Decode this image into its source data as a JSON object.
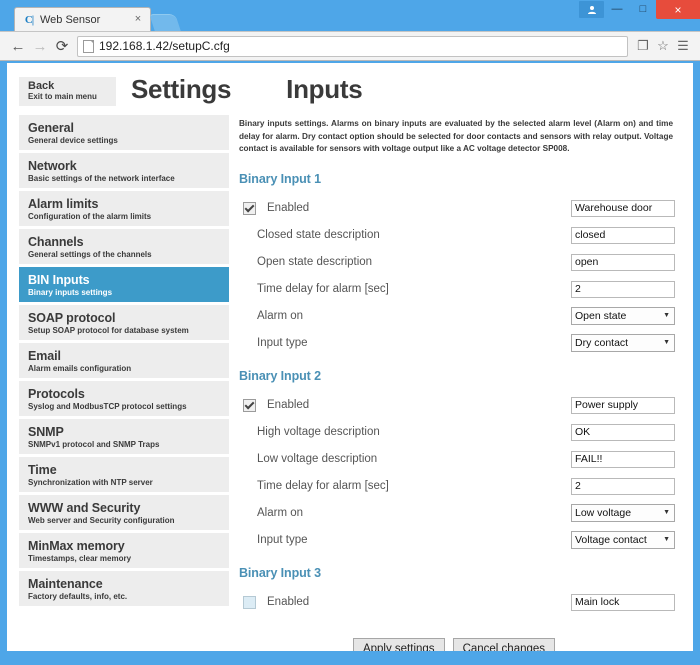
{
  "browser": {
    "tab": {
      "favicon": "cj-logo-icon",
      "title": "Web Sensor",
      "close": "×"
    },
    "window_controls": {
      "minimize": "—",
      "maximize": "□",
      "close": "×"
    },
    "toolbar": {
      "back": "←",
      "forward": "→",
      "reload": "⟳",
      "url": "192.168.1.42/setupC.cfg",
      "copy_icon": "❐",
      "bookmark_icon": "☆",
      "menu_icon": "☰"
    }
  },
  "page": {
    "back_button": {
      "title": "Back",
      "subtitle": "Exit to main menu"
    },
    "settings_title": "Settings",
    "inputs_title": "Inputs",
    "description": "Binary inputs settings. Alarms on binary inputs are evaluated by the selected alarm level (Alarm on) and time delay for alarm. Dry contact option should be selected for door contacts and sensors with relay output. Voltage contact is available for sensors with voltage output like a AC voltage detector SP008.",
    "sidebar": {
      "items": [
        {
          "title": "General",
          "sub": "General device settings",
          "active": false
        },
        {
          "title": "Network",
          "sub": "Basic settings of the network interface",
          "active": false
        },
        {
          "title": "Alarm limits",
          "sub": "Configuration of the alarm limits",
          "active": false
        },
        {
          "title": "Channels",
          "sub": "General settings of the channels",
          "active": false
        },
        {
          "title": "BIN Inputs",
          "sub": "Binary inputs settings",
          "active": true
        },
        {
          "title": "SOAP protocol",
          "sub": "Setup SOAP protocol for database system",
          "active": false
        },
        {
          "title": "Email",
          "sub": "Alarm emails configuration",
          "active": false
        },
        {
          "title": "Protocols",
          "sub": "Syslog and ModbusTCP protocol settings",
          "active": false
        },
        {
          "title": "SNMP",
          "sub": "SNMPv1 protocol and SNMP Traps",
          "active": false
        },
        {
          "title": "Time",
          "sub": "Synchronization with NTP server",
          "active": false
        },
        {
          "title": "WWW and Security",
          "sub": "Web server and Security configuration",
          "active": false
        },
        {
          "title": "MinMax memory",
          "sub": "Timestamps, clear memory",
          "active": false
        },
        {
          "title": "Maintenance",
          "sub": "Factory defaults, info, etc.",
          "active": false
        }
      ]
    },
    "groups": [
      {
        "title": "Binary Input 1",
        "enabled_label": "Enabled",
        "enabled": true,
        "name_value": "Warehouse door",
        "rows": [
          {
            "label": "Closed state description",
            "value": "closed",
            "type": "text"
          },
          {
            "label": "Open state description",
            "value": "open",
            "type": "text"
          },
          {
            "label": "Time delay for alarm [sec]",
            "value": "2",
            "type": "text"
          },
          {
            "label": "Alarm on",
            "value": "Open state",
            "type": "select"
          },
          {
            "label": "Input type",
            "value": "Dry contact",
            "type": "select"
          }
        ]
      },
      {
        "title": "Binary Input 2",
        "enabled_label": "Enabled",
        "enabled": true,
        "name_value": "Power supply",
        "rows": [
          {
            "label": "High voltage description",
            "value": "OK",
            "type": "text"
          },
          {
            "label": "Low voltage description",
            "value": "FAIL!!",
            "type": "text"
          },
          {
            "label": "Time delay for alarm [sec]",
            "value": "2",
            "type": "text"
          },
          {
            "label": "Alarm on",
            "value": "Low voltage",
            "type": "select"
          },
          {
            "label": "Input type",
            "value": "Voltage contact",
            "type": "select"
          }
        ]
      },
      {
        "title": "Binary Input 3",
        "enabled_label": "Enabled",
        "enabled": false,
        "name_value": "Main lock",
        "rows": []
      }
    ],
    "buttons": {
      "apply": "Apply settings",
      "cancel": "Cancel changes"
    }
  },
  "colors": {
    "chrome_blue": "#4ea6e8",
    "accent_blue": "#3d9bc9",
    "heading_blue": "#4a90b5",
    "close_red": "#e74c3c",
    "menu_grey": "#ededed"
  }
}
